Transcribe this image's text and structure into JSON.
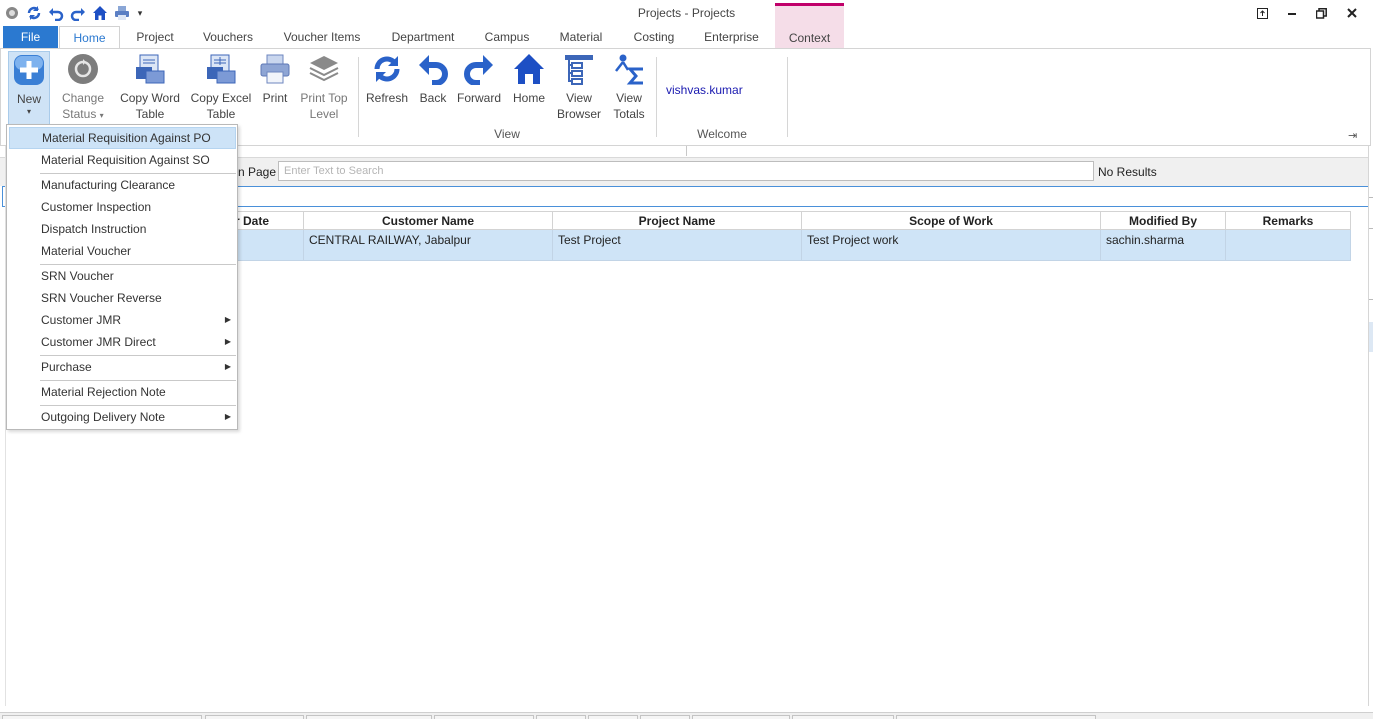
{
  "window": {
    "title": "Projects - Projects",
    "controls": [
      "restore-up-icon",
      "minimize-icon",
      "restore-icon",
      "close-icon"
    ]
  },
  "quick_access": [
    "app-icon",
    "refresh-icon",
    "undo-icon",
    "redo-icon",
    "home-icon",
    "print-icon",
    "customize-dropdown-icon"
  ],
  "tabs": [
    "File",
    "Home",
    "Project",
    "Vouchers",
    "Voucher Items",
    "Department",
    "Campus",
    "Material",
    "Costing",
    "Enterprise",
    "Context"
  ],
  "ribbon": {
    "new_label": "New",
    "change_status_line1": "Change",
    "change_status_line2": "Status",
    "copy_word_line1": "Copy Word",
    "copy_word_line2": "Table",
    "copy_excel_line1": "Copy Excel",
    "copy_excel_line2": "Table",
    "print_label": "Print",
    "print_top_line1": "Print Top",
    "print_top_line2": "Level",
    "refresh_label": "Refresh",
    "back_label": "Back",
    "forward_label": "Forward",
    "home_label": "Home",
    "view_browser_line1": "View",
    "view_browser_line2": "Browser",
    "view_totals_line1": "View",
    "view_totals_line2": "Totals",
    "group_view": "View",
    "group_welcome": "Welcome",
    "welcome_user": "vishvas.kumar",
    "accent_color": "#2b79d0"
  },
  "search": {
    "label": "n Page",
    "placeholder": "Enter Text to Search",
    "value": "",
    "results": "No Results"
  },
  "grid": {
    "headers": [
      "er Date",
      "Customer Name",
      "Project Name",
      "Scope of Work",
      "Modified By",
      "Remarks"
    ],
    "rows": [
      [
        "",
        "CENTRAL RAILWAY, Jabalpur",
        "Test Project",
        "Test Project work",
        "sachin.sharma",
        ""
      ]
    ],
    "selected_row_color": "#cfe4f7"
  },
  "new_menu": {
    "items": [
      {
        "label": "Material Requisition Against PO",
        "highlighted": true
      },
      {
        "label": "Material Requisition Against SO"
      },
      {
        "label": "Manufacturing Clearance"
      },
      {
        "label": "Customer Inspection"
      },
      {
        "label": "Dispatch Instruction"
      },
      {
        "label": "Material Voucher"
      },
      {
        "label": "SRN Voucher"
      },
      {
        "label": "SRN Voucher Reverse"
      },
      {
        "label": "Customer JMR",
        "submenu": true
      },
      {
        "label": "Customer JMR Direct",
        "submenu": true
      },
      {
        "label": "Purchase",
        "submenu": true
      },
      {
        "label": "Material Rejection Note"
      },
      {
        "label": "Outgoing Delivery Note",
        "submenu": true
      }
    ]
  }
}
